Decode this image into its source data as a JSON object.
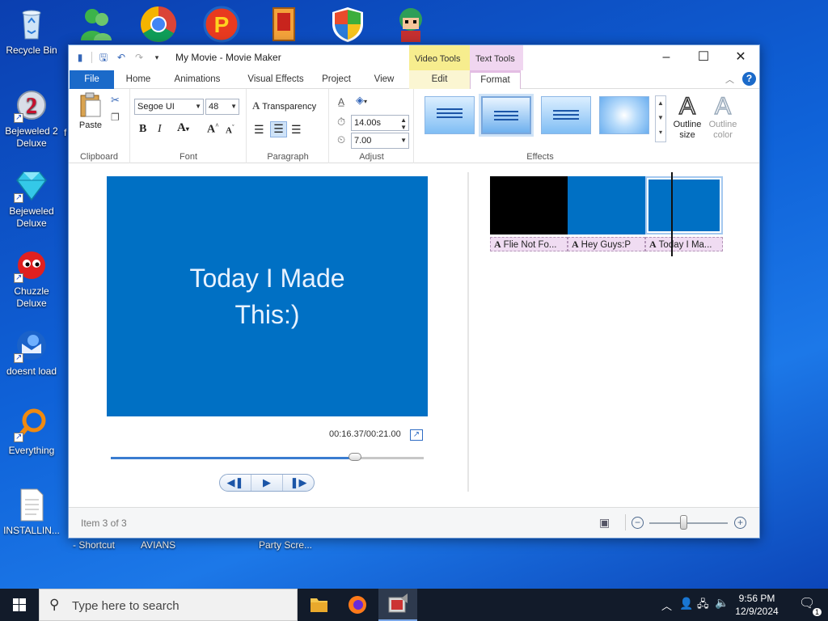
{
  "desktop": {
    "icons": [
      {
        "label": "Recycle Bin"
      },
      {
        "label": "Bejeweled 2 Deluxe"
      },
      {
        "label": "Bejeweled Deluxe"
      },
      {
        "label": "Chuzzle Deluxe"
      },
      {
        "label": "doesnt load"
      },
      {
        "label": "Everything"
      },
      {
        "label": "INSTALLIN..."
      }
    ],
    "partial_labels": [
      "- Shortcut",
      "AVIANS",
      "Party Scre...",
      "f"
    ]
  },
  "window": {
    "title": "My Movie - Movie Maker",
    "context_tabs": {
      "video_tools": "Video Tools",
      "text_tools": "Text Tools"
    },
    "tabs": [
      "File",
      "Home",
      "Animations",
      "Visual Effects",
      "Project",
      "View",
      "Edit",
      "Format"
    ],
    "active_tab": "Format"
  },
  "ribbon": {
    "clipboard": {
      "label": "Clipboard",
      "paste": "Paste"
    },
    "font": {
      "label": "Font",
      "family": "Segoe UI",
      "size": "48"
    },
    "paragraph": {
      "label": "Paragraph",
      "transparency": "Transparency"
    },
    "adjust": {
      "label": "Adjust",
      "start_time": "14.00s",
      "duration": "7.00"
    },
    "effects": {
      "label": "Effects",
      "outline_size": "Outline size",
      "outline_color": "Outline color"
    }
  },
  "preview": {
    "text_line1": "Today I Made",
    "text_line2": "This:)",
    "timecode": "00:16.37/00:21.00",
    "progress": 0.78
  },
  "storyboard": {
    "clips": [
      {
        "color": "#000000",
        "caption": "Flie Not Fo..."
      },
      {
        "color": "#0070c4",
        "caption": "Hey Guys:P"
      },
      {
        "color": "#0070c4",
        "caption": "Today I Ma..."
      }
    ]
  },
  "status": {
    "item_text": "Item 3 of 3",
    "zoom": 0.4
  },
  "taskbar": {
    "search_placeholder": "Type here to search",
    "time": "9:56 PM",
    "date": "12/9/2024",
    "notification_count": "1"
  },
  "colors": {
    "accent": "#1b6ac9",
    "preview_bg": "#0070c4",
    "video_tools": "#f7ed8e",
    "text_tools": "#f0d6f0"
  }
}
